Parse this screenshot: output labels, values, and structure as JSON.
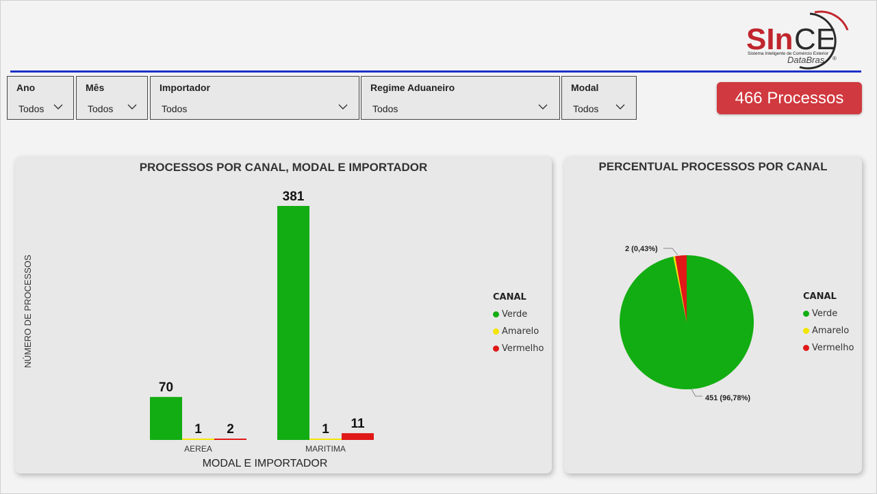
{
  "logo": {
    "name_red": "SIn",
    "name_dark": "CE",
    "tagline": "Sistema Inteligente de Comércio Exterior",
    "brand": "DataBras",
    "registered": "®"
  },
  "filters": [
    {
      "label": "Ano",
      "value": "Todos"
    },
    {
      "label": "Mês",
      "value": "Todos"
    },
    {
      "label": "Importador",
      "value": "Todos"
    },
    {
      "label": "Regime Aduaneiro",
      "value": "Todos"
    },
    {
      "label": "Modal",
      "value": "Todos"
    }
  ],
  "process_count": "466 Processos",
  "colors": {
    "verde": "#12ad12",
    "amarelo": "#f2e600",
    "vermelho": "#e01818",
    "accent": "#d0393f",
    "line": "#1a2fc9"
  },
  "legend": {
    "title": "CANAL",
    "items": [
      "Verde",
      "Amarelo",
      "Vermelho"
    ]
  },
  "chart_data": [
    {
      "type": "bar",
      "title": "PROCESSOS POR CANAL, MODAL E IMPORTADOR",
      "xlabel": "MODAL E IMPORTADOR",
      "ylabel": "NÚMERO DE PROCESSOS",
      "categories": [
        "AEREA",
        "MARITIMA"
      ],
      "series": [
        {
          "name": "Verde",
          "values": [
            70,
            381
          ]
        },
        {
          "name": "Amarelo",
          "values": [
            1,
            1
          ]
        },
        {
          "name": "Vermelho",
          "values": [
            2,
            11
          ]
        }
      ],
      "ylim": [
        0,
        381
      ],
      "grid": false,
      "legend_position": "right"
    },
    {
      "type": "pie",
      "title": "PERCENTUAL PROCESSOS POR CANAL",
      "labels": [
        "Verde",
        "Amarelo",
        "Vermelho"
      ],
      "values": [
        451,
        2,
        13
      ],
      "data_labels": [
        "451 (96,78%)",
        "",
        "2 (0,43%)"
      ],
      "legend_position": "right"
    }
  ]
}
